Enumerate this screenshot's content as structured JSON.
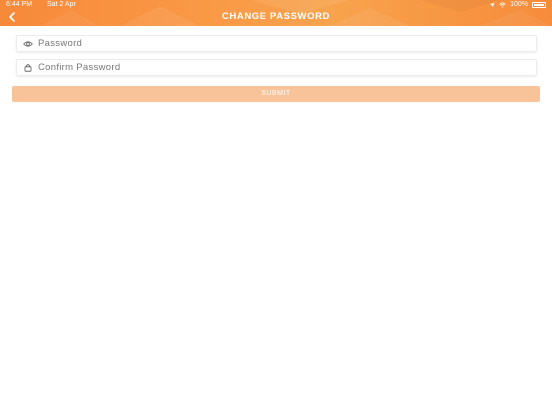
{
  "status_bar": {
    "time": "6:44 PM",
    "date": "Sat 2 Apr",
    "battery": "100%"
  },
  "header": {
    "title": "CHANGE PASSWORD",
    "color": "#f7893a"
  },
  "form": {
    "password_placeholder": "Password",
    "confirm_placeholder": "Confirm Password",
    "submit_label": "SUBMIT",
    "submit_color": "#f9c39a"
  },
  "icons": {
    "back": "chevron-left-icon",
    "password": "eye-icon",
    "confirm": "lock-icon"
  }
}
